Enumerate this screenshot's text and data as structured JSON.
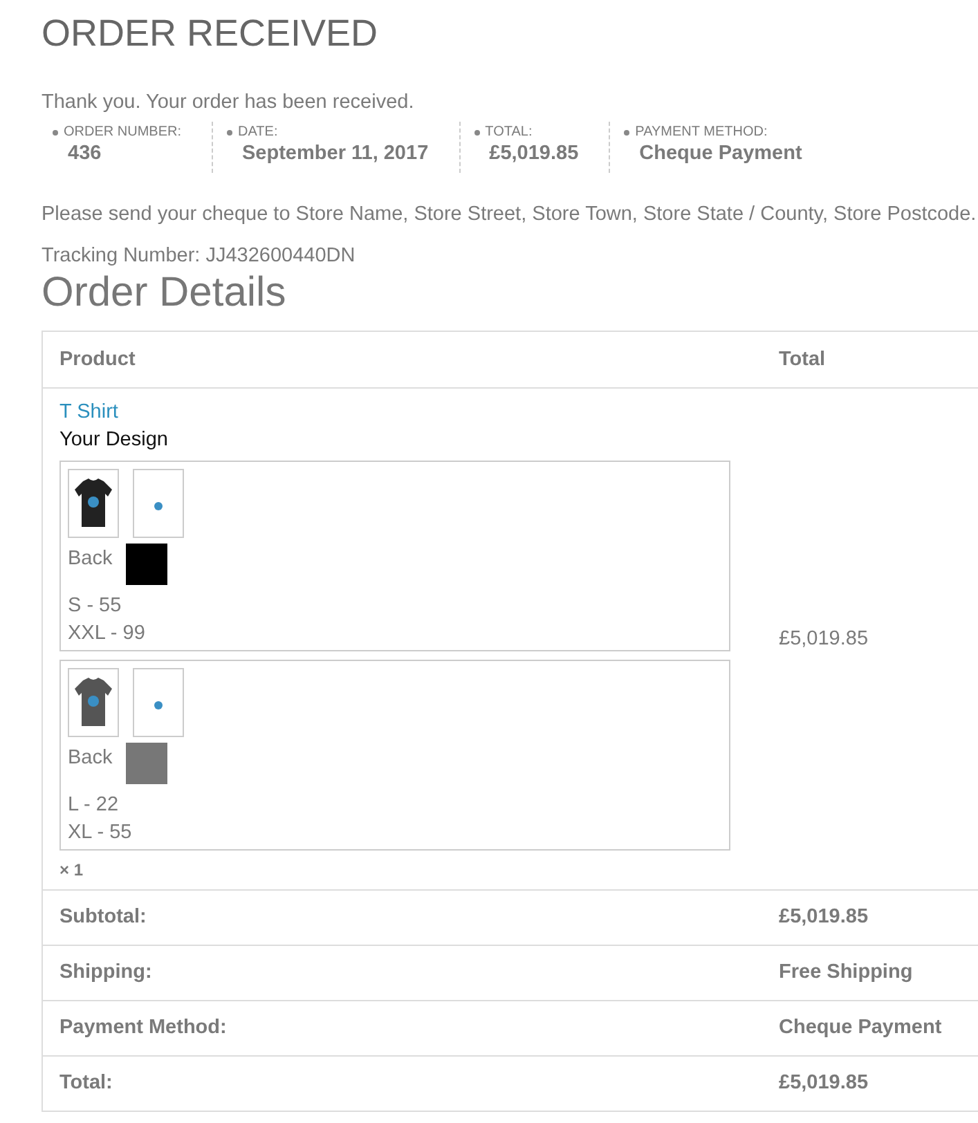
{
  "title": "ORDER RECEIVED",
  "thank_you": "Thank you. Your order has been received.",
  "overview": [
    {
      "label": "ORDER NUMBER:",
      "value": "436"
    },
    {
      "label": "DATE:",
      "value": "September 11, 2017"
    },
    {
      "label": "TOTAL:",
      "value": "£5,019.85"
    },
    {
      "label": "PAYMENT METHOD:",
      "value": "Cheque Payment"
    }
  ],
  "instructions": "Please send your cheque to Store Name, Store Street, Store Town, Store State / County, Store Postcode.",
  "tracking": "Tracking Number: JJ432600440DN",
  "details_heading": "Order Details",
  "table": {
    "columns": [
      "Product",
      "Total"
    ],
    "item": {
      "name": "T Shirt",
      "subtitle": "Your Design",
      "quantity": "× 1",
      "total": "£5,019.85",
      "designs": [
        {
          "side": "Back",
          "color": "#000000",
          "sizes": [
            "S - 55",
            "XXL - 99"
          ]
        },
        {
          "side": "Back",
          "color": "#777777",
          "sizes": [
            "L - 22",
            "XL - 55"
          ]
        }
      ]
    },
    "totals": [
      {
        "label": "Subtotal:",
        "value": "£5,019.85"
      },
      {
        "label": "Shipping:",
        "value": "Free Shipping"
      },
      {
        "label": "Payment Method:",
        "value": "Cheque Payment"
      },
      {
        "label": "Total:",
        "value": "£5,019.85"
      }
    ]
  }
}
